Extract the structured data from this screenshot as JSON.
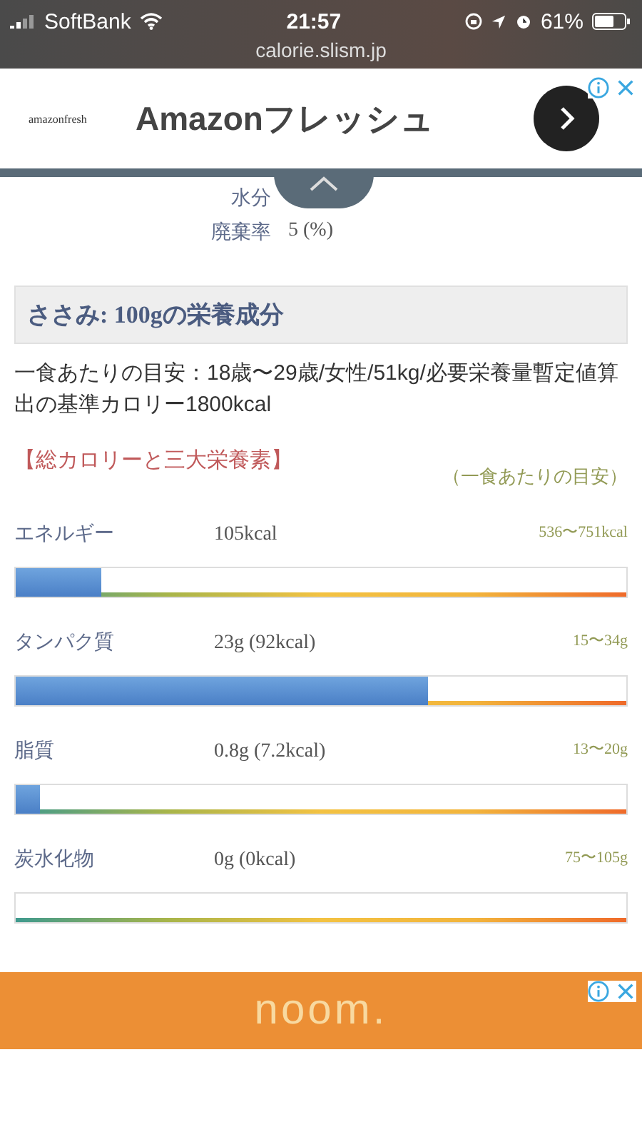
{
  "status_bar": {
    "carrier": "SoftBank",
    "time": "21:57",
    "battery": "61%",
    "url": "calorie.slism.jp"
  },
  "top_ad": {
    "brand": "amazonfresh",
    "headline": "Amazonフレッシュ"
  },
  "facts": [
    {
      "label": "水分"
    },
    {
      "label": "廃棄率",
      "value": "5 (%)"
    }
  ],
  "section_title": "ささみ: 100gの栄養成分",
  "description": "一食あたりの目安：18歳〜29歳/女性/51kg/必要栄養量暫定値算出の基準カロリー1800kcal",
  "nutrients_heading": "【総カロリーと三大栄養素】",
  "target_note": "（一食あたりの目安）",
  "nutrients": [
    {
      "name": "エネルギー",
      "amount": "105kcal",
      "target": "536〜751kcal",
      "level": 0.14
    },
    {
      "name": "タンパク質",
      "amount": "23g (92kcal)",
      "target": "15〜34g",
      "level": 0.675
    },
    {
      "name": "脂質",
      "amount": "0.8g (7.2kcal)",
      "target": "13〜20g",
      "level": 0.04
    },
    {
      "name": "炭水化物",
      "amount": "0g (0kcal)",
      "target": "75〜105g"
    }
  ],
  "bottom_ad": {
    "brand": "noom."
  }
}
